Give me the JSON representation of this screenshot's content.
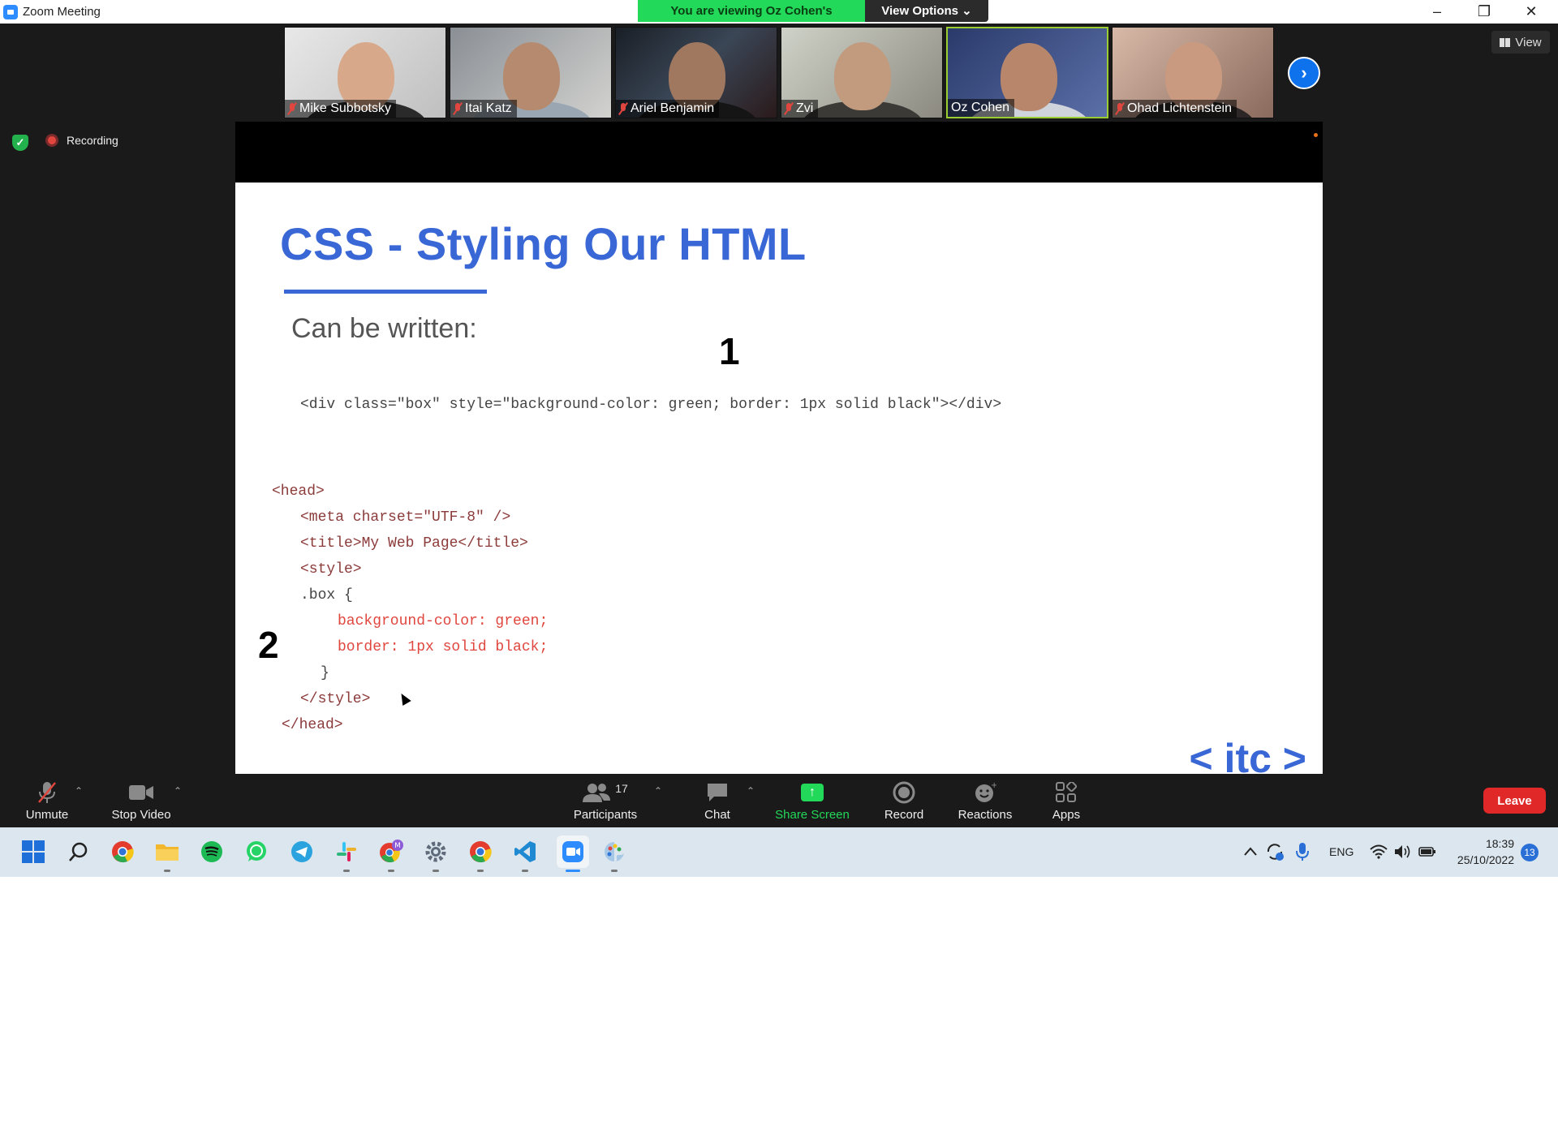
{
  "window": {
    "title": "Zoom Meeting",
    "minimize": "–",
    "restore": "❐",
    "close": "✕"
  },
  "banner": {
    "viewing": "You are viewing Oz Cohen's screen",
    "view_options": "View Options ⌄"
  },
  "participants": [
    {
      "name": "Mike Subbotsky",
      "muted": true
    },
    {
      "name": "Itai Katz",
      "muted": true
    },
    {
      "name": "Ariel Benjamin",
      "muted": true
    },
    {
      "name": "Zvi",
      "muted": true
    },
    {
      "name": "Oz Cohen",
      "muted": false
    },
    {
      "name": "Ohad Lichtenstein",
      "muted": true
    }
  ],
  "gallery": {
    "next": "›",
    "view_label": "View"
  },
  "status": {
    "recording": "Recording"
  },
  "slide": {
    "title": "CSS - Styling Our HTML",
    "subtitle": "Can be written:",
    "marker1": "1",
    "marker2": "2",
    "inline_code": "<div class=\"box\" style=\"background-color: green; border: 1px solid black\"></div>",
    "head_code": {
      "l1": "<head>",
      "l2": "<meta charset=\"UTF-8\" />",
      "l3": "<title>My Web Page</title>",
      "l4": "<style>",
      "l5": ".box {",
      "l6": "background-color: green;",
      "l7": "border: 1px solid black;",
      "l8": "}",
      "l9": "</style>",
      "l10": "</head>"
    },
    "brand": "< itc >"
  },
  "toolbar": {
    "unmute": "Unmute",
    "stop_video": "Stop Video",
    "participants": "Participants",
    "participants_count": "17",
    "chat": "Chat",
    "share_screen": "Share Screen",
    "record": "Record",
    "reactions": "Reactions",
    "apps": "Apps",
    "leave": "Leave"
  },
  "taskbar": {
    "language": "ENG",
    "time": "18:39",
    "date": "25/10/2022",
    "notifications": "13",
    "chrome_badge": "M"
  }
}
